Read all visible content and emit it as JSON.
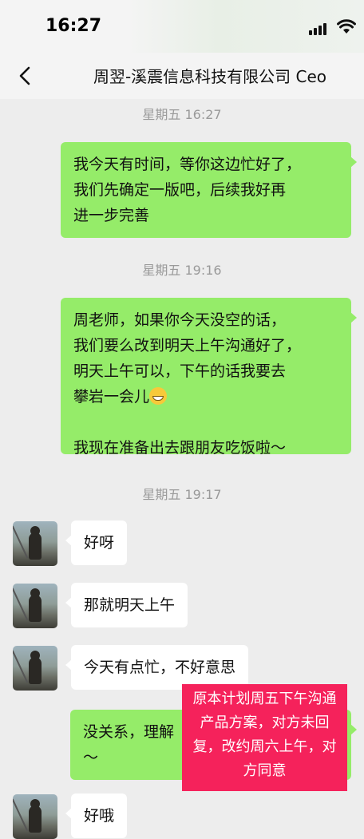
{
  "status_bar": {
    "time": "16:27"
  },
  "header": {
    "back_icon": "chevron-left-icon",
    "title": "周翌-溪震信息科技有限公司 Ceo"
  },
  "messages": [
    {
      "type": "timestamp",
      "text": "星期五 16:27"
    },
    {
      "type": "outgoing",
      "text": "我今天有时间，等你这边忙好了，\n我们先确定一版吧，后续我好再\n进一步完善"
    },
    {
      "type": "timestamp",
      "text": "星期五 19:16"
    },
    {
      "type": "outgoing",
      "line1": "周老师，如果你今天没空的话，\n我们要么改到明天上午沟通好了，\n明天上午可以，下午的话我要去\n攀岩一会儿",
      "emoji": "grinning-emoji",
      "line2": "我现在准备出去跟朋友吃饭啦～"
    },
    {
      "type": "timestamp",
      "text": "星期五 19:17"
    },
    {
      "type": "incoming",
      "text": "好呀"
    },
    {
      "type": "incoming",
      "text": "那就明天上午"
    },
    {
      "type": "incoming",
      "text": "今天有点忙，不好意思"
    },
    {
      "type": "outgoing",
      "text": "没关系，理解\n～"
    },
    {
      "type": "incoming",
      "text": "好哦"
    }
  ],
  "annotation": {
    "text": "原本计划周五下午沟通\n产品方案，对方未回\n复，改约周六上午，对\n方同意",
    "color": "#f5225b"
  },
  "colors": {
    "outgoing_bubble": "#95ec69",
    "incoming_bubble": "#ffffff",
    "background": "#ededed"
  }
}
